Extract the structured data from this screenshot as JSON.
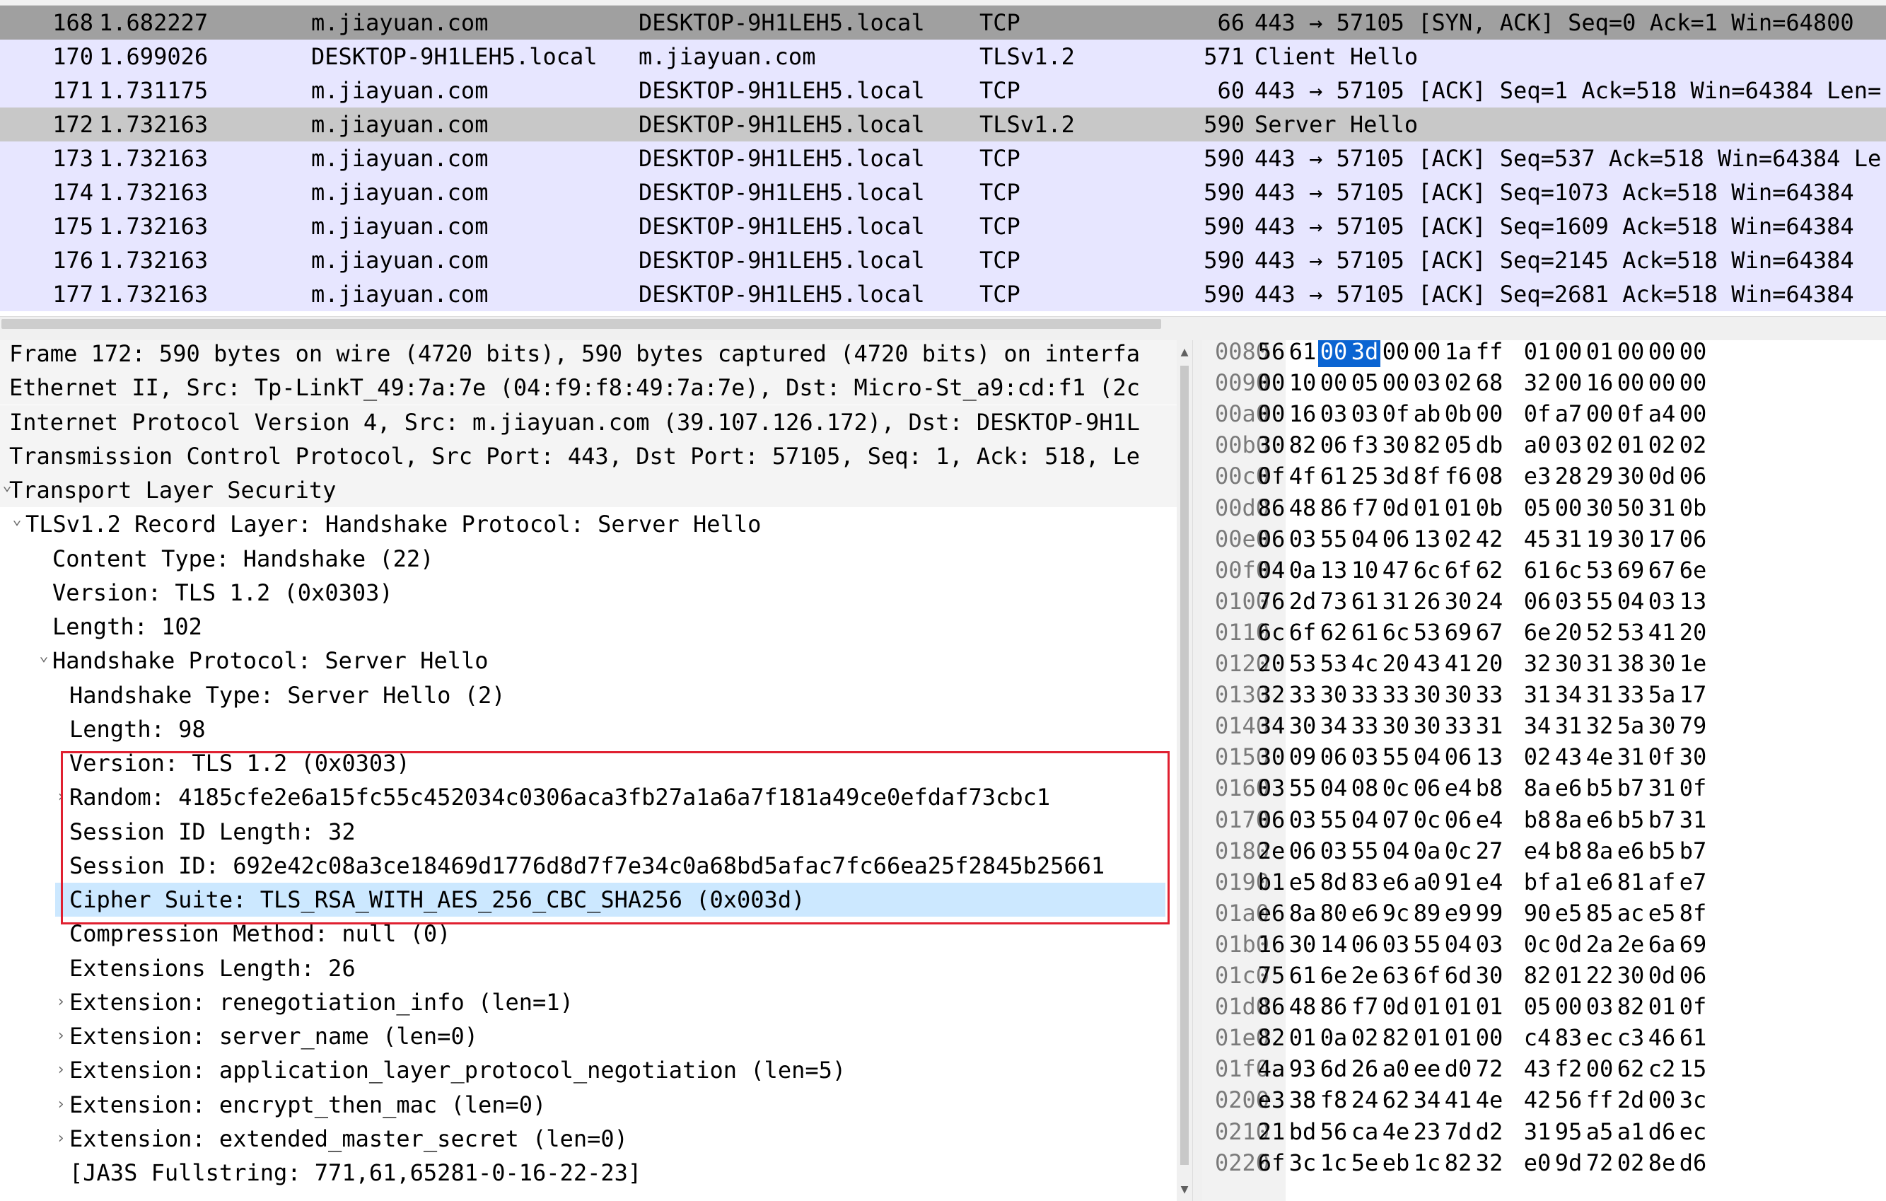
{
  "packet_list": {
    "rows": [
      {
        "no": "168",
        "time": "1.682227",
        "source": "m.jiayuan.com",
        "destination": "DESKTOP-9H1LEH5.local",
        "protocol": "TCP",
        "length": "66",
        "info": "443 → 57105 [SYN, ACK] Seq=0 Ack=1 Win=64800",
        "style": "gray"
      },
      {
        "no": "170",
        "time": "1.699026",
        "source": "DESKTOP-9H1LEH5.local",
        "destination": "m.jiayuan.com",
        "protocol": "TLSv1.2",
        "length": "571",
        "info": "Client Hello",
        "style": "tls"
      },
      {
        "no": "171",
        "time": "1.731175",
        "source": "m.jiayuan.com",
        "destination": "DESKTOP-9H1LEH5.local",
        "protocol": "TCP",
        "length": "60",
        "info": "443 → 57105 [ACK] Seq=1 Ack=518 Win=64384 Len=",
        "style": "tcp"
      },
      {
        "no": "172",
        "time": "1.732163",
        "source": "m.jiayuan.com",
        "destination": "DESKTOP-9H1LEH5.local",
        "protocol": "TLSv1.2",
        "length": "590",
        "info": "Server Hello",
        "style": "selected"
      },
      {
        "no": "173",
        "time": "1.732163",
        "source": "m.jiayuan.com",
        "destination": "DESKTOP-9H1LEH5.local",
        "protocol": "TCP",
        "length": "590",
        "info": "443 → 57105 [ACK] Seq=537 Ack=518 Win=64384 Le",
        "style": "tcp"
      },
      {
        "no": "174",
        "time": "1.732163",
        "source": "m.jiayuan.com",
        "destination": "DESKTOP-9H1LEH5.local",
        "protocol": "TCP",
        "length": "590",
        "info": "443 → 57105 [ACK] Seq=1073 Ack=518 Win=64384",
        "style": "tcp"
      },
      {
        "no": "175",
        "time": "1.732163",
        "source": "m.jiayuan.com",
        "destination": "DESKTOP-9H1LEH5.local",
        "protocol": "TCP",
        "length": "590",
        "info": "443 → 57105 [ACK] Seq=1609 Ack=518 Win=64384",
        "style": "tcp"
      },
      {
        "no": "176",
        "time": "1.732163",
        "source": "m.jiayuan.com",
        "destination": "DESKTOP-9H1LEH5.local",
        "protocol": "TCP",
        "length": "590",
        "info": "443 → 57105 [ACK] Seq=2145 Ack=518 Win=64384",
        "style": "tcp"
      },
      {
        "no": "177",
        "time": "1.732163",
        "source": "m.jiayuan.com",
        "destination": "DESKTOP-9H1LEH5.local",
        "protocol": "TCP",
        "length": "590",
        "info": "443 → 57105 [ACK] Seq=2681 Ack=518 Win=64384",
        "style": "tcp"
      }
    ]
  },
  "details": {
    "lines": [
      {
        "text": "Frame 172: 590 bytes on wire (4720 bits), 590 bytes captured (4720 bits) on interfa",
        "indent": 0,
        "arrow": "none",
        "top_level": true
      },
      {
        "text": "Ethernet II, Src: Tp-LinkT_49:7a:7e (04:f9:f8:49:7a:7e), Dst: Micro-St_a9:cd:f1 (2c",
        "indent": 0,
        "arrow": "none",
        "top_level": true
      },
      {
        "text": "Internet Protocol Version 4, Src: m.jiayuan.com (39.107.126.172), Dst: DESKTOP-9H1L",
        "indent": 0,
        "arrow": "none",
        "top_level": true
      },
      {
        "text": "Transmission Control Protocol, Src Port: 443, Dst Port: 57105, Seq: 1, Ack: 518, Le",
        "indent": 0,
        "arrow": "none",
        "top_level": true
      },
      {
        "text": "Transport Layer Security",
        "indent": 0,
        "arrow": "expanded",
        "top_level": true
      },
      {
        "text": "TLSv1.2 Record Layer: Handshake Protocol: Server Hello",
        "indent": 1,
        "arrow": "expanded"
      },
      {
        "text": "Content Type: Handshake (22)",
        "indent": 2,
        "arrow": "none"
      },
      {
        "text": "Version: TLS 1.2 (0x0303)",
        "indent": 2,
        "arrow": "none"
      },
      {
        "text": "Length: 102",
        "indent": 2,
        "arrow": "none"
      },
      {
        "text": "Handshake Protocol: Server Hello",
        "indent": 2,
        "arrow": "expanded"
      },
      {
        "text": "Handshake Type: Server Hello (2)",
        "indent": 3,
        "arrow": "none"
      },
      {
        "text": "Length: 98",
        "indent": 3,
        "arrow": "none"
      },
      {
        "text": "Version: TLS 1.2 (0x0303)",
        "indent": 3,
        "arrow": "none"
      },
      {
        "text": "Random: 4185cfe2e6a15fc55c452034c0306aca3fb27a1a6a7f181a49ce0efdaf73cbc1",
        "indent": 3,
        "arrow": "collapsed"
      },
      {
        "text": "Session ID Length: 32",
        "indent": 3,
        "arrow": "none"
      },
      {
        "text": "Session ID: 692e42c08a3ce18469d1776d8d7f7e34c0a68bd5afac7fc66ea25f2845b25661",
        "indent": 3,
        "arrow": "none"
      },
      {
        "text": "Cipher Suite: TLS_RSA_WITH_AES_256_CBC_SHA256 (0x003d)",
        "indent": 3,
        "arrow": "none",
        "selected": true
      },
      {
        "text": "Compression Method: null (0)",
        "indent": 3,
        "arrow": "none"
      },
      {
        "text": "Extensions Length: 26",
        "indent": 3,
        "arrow": "none"
      },
      {
        "text": "Extension: renegotiation_info (len=1)",
        "indent": 3,
        "arrow": "collapsed"
      },
      {
        "text": "Extension: server_name (len=0)",
        "indent": 3,
        "arrow": "collapsed"
      },
      {
        "text": "Extension: application_layer_protocol_negotiation (len=5)",
        "indent": 3,
        "arrow": "collapsed"
      },
      {
        "text": "Extension: encrypt_then_mac (len=0)",
        "indent": 3,
        "arrow": "collapsed"
      },
      {
        "text": "Extension: extended_master_secret (len=0)",
        "indent": 3,
        "arrow": "collapsed"
      },
      {
        "text": "[JA3S Fullstring: 771,61,65281-0-16-22-23]",
        "indent": 3,
        "arrow": "none"
      }
    ]
  },
  "hex": {
    "rows": [
      {
        "offset": "0080",
        "bytes": [
          "56",
          "61",
          "00",
          "3d",
          "00",
          "00",
          "1a",
          "ff",
          "01",
          "00",
          "01",
          "00",
          "00",
          "00"
        ]
      },
      {
        "offset": "0090",
        "bytes": [
          "00",
          "10",
          "00",
          "05",
          "00",
          "03",
          "02",
          "68",
          "32",
          "00",
          "16",
          "00",
          "00",
          "00"
        ]
      },
      {
        "offset": "00a0",
        "bytes": [
          "00",
          "16",
          "03",
          "03",
          "0f",
          "ab",
          "0b",
          "00",
          "0f",
          "a7",
          "00",
          "0f",
          "a4",
          "00"
        ]
      },
      {
        "offset": "00b0",
        "bytes": [
          "30",
          "82",
          "06",
          "f3",
          "30",
          "82",
          "05",
          "db",
          "a0",
          "03",
          "02",
          "01",
          "02",
          "02"
        ]
      },
      {
        "offset": "00c0",
        "bytes": [
          "0f",
          "4f",
          "61",
          "25",
          "3d",
          "8f",
          "f6",
          "08",
          "e3",
          "28",
          "29",
          "30",
          "0d",
          "06"
        ]
      },
      {
        "offset": "00d0",
        "bytes": [
          "86",
          "48",
          "86",
          "f7",
          "0d",
          "01",
          "01",
          "0b",
          "05",
          "00",
          "30",
          "50",
          "31",
          "0b"
        ]
      },
      {
        "offset": "00e0",
        "bytes": [
          "06",
          "03",
          "55",
          "04",
          "06",
          "13",
          "02",
          "42",
          "45",
          "31",
          "19",
          "30",
          "17",
          "06"
        ]
      },
      {
        "offset": "00f0",
        "bytes": [
          "04",
          "0a",
          "13",
          "10",
          "47",
          "6c",
          "6f",
          "62",
          "61",
          "6c",
          "53",
          "69",
          "67",
          "6e"
        ]
      },
      {
        "offset": "0100",
        "bytes": [
          "76",
          "2d",
          "73",
          "61",
          "31",
          "26",
          "30",
          "24",
          "06",
          "03",
          "55",
          "04",
          "03",
          "13"
        ]
      },
      {
        "offset": "0110",
        "bytes": [
          "6c",
          "6f",
          "62",
          "61",
          "6c",
          "53",
          "69",
          "67",
          "6e",
          "20",
          "52",
          "53",
          "41",
          "20"
        ]
      },
      {
        "offset": "0120",
        "bytes": [
          "20",
          "53",
          "53",
          "4c",
          "20",
          "43",
          "41",
          "20",
          "32",
          "30",
          "31",
          "38",
          "30",
          "1e"
        ]
      },
      {
        "offset": "0130",
        "bytes": [
          "32",
          "33",
          "30",
          "33",
          "33",
          "30",
          "30",
          "33",
          "31",
          "34",
          "31",
          "33",
          "5a",
          "17"
        ]
      },
      {
        "offset": "0140",
        "bytes": [
          "34",
          "30",
          "34",
          "33",
          "30",
          "30",
          "33",
          "31",
          "34",
          "31",
          "32",
          "5a",
          "30",
          "79"
        ]
      },
      {
        "offset": "0150",
        "bytes": [
          "30",
          "09",
          "06",
          "03",
          "55",
          "04",
          "06",
          "13",
          "02",
          "43",
          "4e",
          "31",
          "0f",
          "30"
        ]
      },
      {
        "offset": "0160",
        "bytes": [
          "03",
          "55",
          "04",
          "08",
          "0c",
          "06",
          "e4",
          "b8",
          "8a",
          "e6",
          "b5",
          "b7",
          "31",
          "0f"
        ]
      },
      {
        "offset": "0170",
        "bytes": [
          "06",
          "03",
          "55",
          "04",
          "07",
          "0c",
          "06",
          "e4",
          "b8",
          "8a",
          "e6",
          "b5",
          "b7",
          "31"
        ]
      },
      {
        "offset": "0180",
        "bytes": [
          "2e",
          "06",
          "03",
          "55",
          "04",
          "0a",
          "0c",
          "27",
          "e4",
          "b8",
          "8a",
          "e6",
          "b5",
          "b7"
        ]
      },
      {
        "offset": "0190",
        "bytes": [
          "b1",
          "e5",
          "8d",
          "83",
          "e6",
          "a0",
          "91",
          "e4",
          "bf",
          "a1",
          "e6",
          "81",
          "af",
          "e7"
        ]
      },
      {
        "offset": "01a0",
        "bytes": [
          "e6",
          "8a",
          "80",
          "e6",
          "9c",
          "89",
          "e9",
          "99",
          "90",
          "e5",
          "85",
          "ac",
          "e5",
          "8f"
        ]
      },
      {
        "offset": "01b0",
        "bytes": [
          "16",
          "30",
          "14",
          "06",
          "03",
          "55",
          "04",
          "03",
          "0c",
          "0d",
          "2a",
          "2e",
          "6a",
          "69"
        ]
      },
      {
        "offset": "01c0",
        "bytes": [
          "75",
          "61",
          "6e",
          "2e",
          "63",
          "6f",
          "6d",
          "30",
          "82",
          "01",
          "22",
          "30",
          "0d",
          "06"
        ]
      },
      {
        "offset": "01d0",
        "bytes": [
          "86",
          "48",
          "86",
          "f7",
          "0d",
          "01",
          "01",
          "01",
          "05",
          "00",
          "03",
          "82",
          "01",
          "0f"
        ]
      },
      {
        "offset": "01e0",
        "bytes": [
          "82",
          "01",
          "0a",
          "02",
          "82",
          "01",
          "01",
          "00",
          "c4",
          "83",
          "ec",
          "c3",
          "46",
          "61"
        ]
      },
      {
        "offset": "01f0",
        "bytes": [
          "4a",
          "93",
          "6d",
          "26",
          "a0",
          "ee",
          "d0",
          "72",
          "43",
          "f2",
          "00",
          "62",
          "c2",
          "15"
        ]
      },
      {
        "offset": "0200",
        "bytes": [
          "e3",
          "38",
          "f8",
          "24",
          "62",
          "34",
          "41",
          "4e",
          "42",
          "56",
          "ff",
          "2d",
          "00",
          "3c"
        ]
      },
      {
        "offset": "0210",
        "bytes": [
          "21",
          "bd",
          "56",
          "ca",
          "4e",
          "23",
          "7d",
          "d2",
          "31",
          "95",
          "a5",
          "a1",
          "d6",
          "ec"
        ]
      },
      {
        "offset": "0220",
        "bytes": [
          "6f",
          "3c",
          "1c",
          "5e",
          "eb",
          "1c",
          "82",
          "32",
          "e0",
          "9d",
          "72",
          "02",
          "8e",
          "d6"
        ]
      }
    ],
    "highlight": {
      "row": 0,
      "start": 2,
      "end": 3
    }
  },
  "colors": {
    "row_tcp": "#e7e6ff",
    "row_gray": "#a0a0a0",
    "row_selected": "#c8c8c8",
    "detail_selected": "#cce8ff",
    "hex_highlight": "#0a64d2",
    "annotation_box": "#e02030"
  }
}
